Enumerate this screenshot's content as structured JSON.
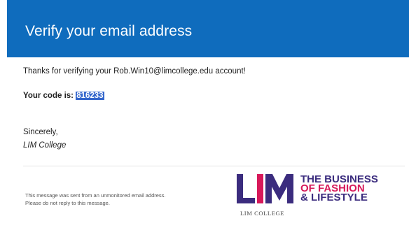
{
  "header": {
    "title": "Verify your email address"
  },
  "body": {
    "intro": "Thanks for verifying your Rob.Win10@limcollege.edu account!",
    "code_label": "Your code is: ",
    "code": "816233",
    "sincerely": "Sincerely,",
    "signature": "LIM College"
  },
  "footer": {
    "note_line1": "This message was sent from an unmonitored email address.",
    "note_line2": "Please do not reply to this message."
  },
  "logo": {
    "brand_text": "LIM",
    "tagline_1": "THE BUSINESS",
    "tagline_2": "OF FASHION",
    "tagline_3": "& LIFESTYLE",
    "college_text": "LIM COLLEGE"
  },
  "colors": {
    "header_bg": "#0f6cbd",
    "code_highlight": "#3366cc",
    "logo_purple": "#3b2c7e",
    "logo_pink": "#d7195a"
  }
}
